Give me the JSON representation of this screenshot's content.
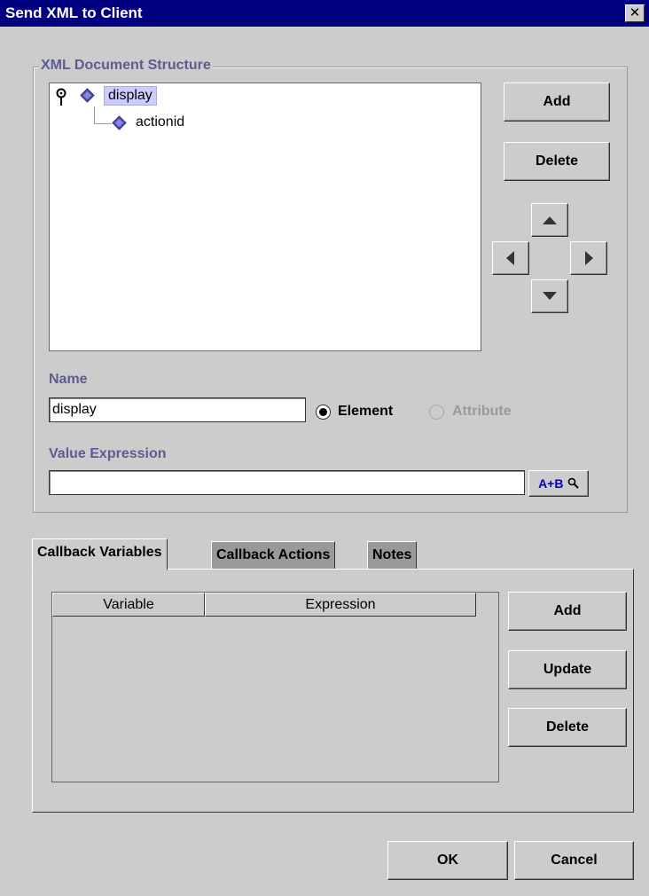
{
  "window": {
    "title": "Send XML to Client",
    "close_label": "✕"
  },
  "structure": {
    "group_title": "XML Document Structure",
    "tree": [
      {
        "label": "display",
        "selected": true
      },
      {
        "label": "actionid",
        "selected": false
      }
    ],
    "add_label": "Add",
    "delete_label": "Delete"
  },
  "name_section": {
    "label": "Name",
    "value": "display",
    "element_label": "Element",
    "attribute_label": "Attribute",
    "selected": "Element"
  },
  "value_expression": {
    "label": "Value Expression",
    "value": "",
    "builder_label": "A+B"
  },
  "tabs": [
    {
      "label": "Callback Variables",
      "active": true
    },
    {
      "label": "Callback Actions",
      "active": false
    },
    {
      "label": "Notes",
      "active": false
    }
  ],
  "callback_table": {
    "columns": [
      "Variable",
      "Expression"
    ],
    "rows": []
  },
  "callback_buttons": {
    "add": "Add",
    "update": "Update",
    "delete": "Delete"
  },
  "footer": {
    "ok": "OK",
    "cancel": "Cancel"
  },
  "colors": {
    "title_bar": "#000080",
    "group_label": "#5c5c92",
    "selection": "#ccccff",
    "node_icon": "#5050b0"
  }
}
